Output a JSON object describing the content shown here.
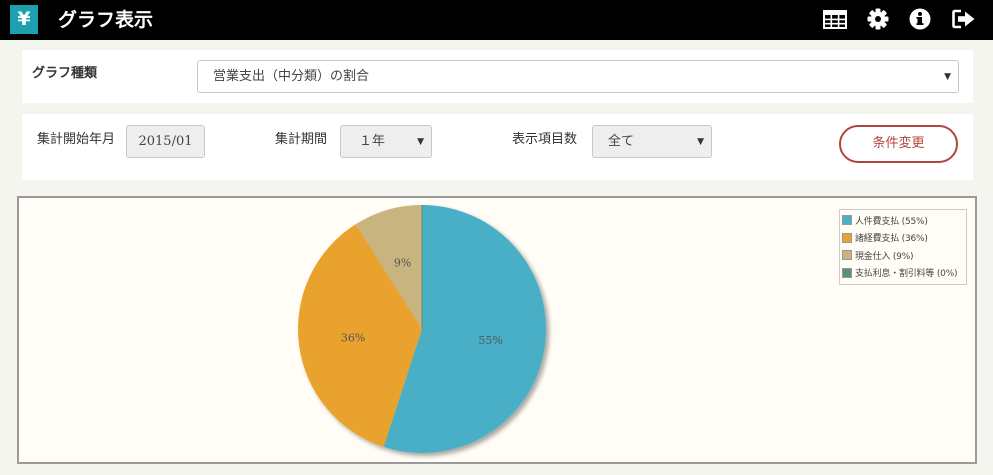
{
  "header": {
    "logo_char": "¥",
    "title": "グラフ表示",
    "icons": [
      "table-icon",
      "gear-icon",
      "info-icon",
      "logout-icon"
    ]
  },
  "graph_type": {
    "label": "グラフ種類",
    "value": "営業支出（中分類）の割合"
  },
  "conditions": {
    "start_label": "集計開始年月",
    "start_value": "2015/01",
    "period_label": "集計期間",
    "period_value": "１年",
    "items_label": "表示項目数",
    "items_value": "全て",
    "change_button": "条件変更"
  },
  "colors": {
    "header_bg": "#000000",
    "logo_bg": "#1da1b0",
    "accent_button": "#b5443f",
    "chart_bg": "#fffdf5"
  },
  "chart_data": {
    "type": "pie",
    "categories": [
      "人件費支払",
      "諸経費支払",
      "現金仕入",
      "支払利息・割引料等"
    ],
    "values": [
      55,
      36,
      9,
      0
    ],
    "slice_labels": [
      "55%",
      "36%",
      "9%",
      ""
    ],
    "legend_labels": [
      "人件費支払 (55%)",
      "諸経費支払 (36%)",
      "現金仕入 (9%)",
      "支払利息・割引料等 (0%)"
    ],
    "colors": [
      "#4aafc7",
      "#eaa22d",
      "#c8b47f",
      "#5b9178"
    ],
    "legend_position": "top-right"
  }
}
